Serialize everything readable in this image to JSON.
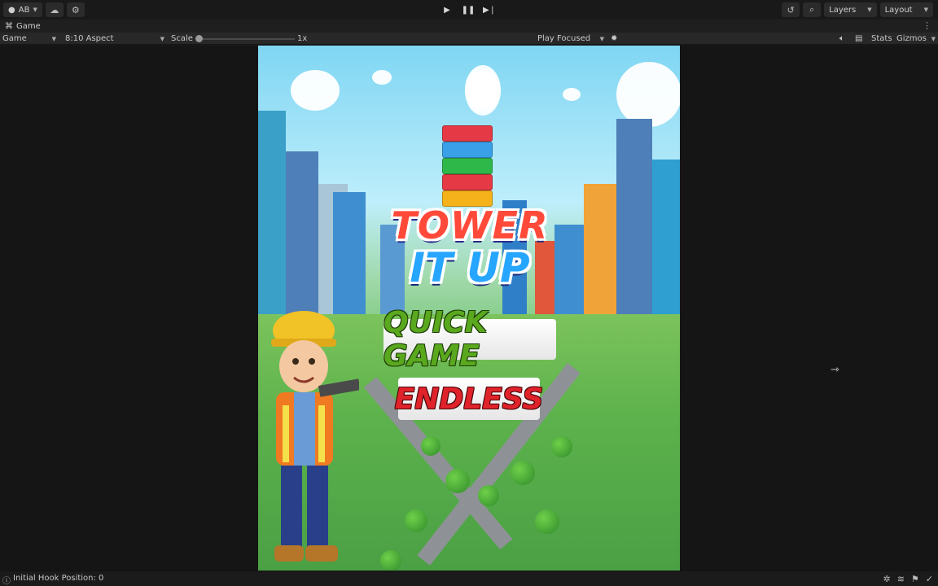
{
  "toolbar": {
    "account_label": "AB",
    "layers_label": "Layers",
    "layout_label": "Layout",
    "icons": [
      "account-icon",
      "cloud-icon",
      "settings-icon",
      "play-icon",
      "pause-icon",
      "step-icon",
      "history-icon",
      "search-icon"
    ]
  },
  "tab": {
    "label": "Game"
  },
  "gamebar": {
    "display_label": "Game",
    "aspect_label": "8:10 Aspect",
    "scale_label": "Scale",
    "scale_value": "1x",
    "scale_fraction": 0.0,
    "play_mode_label": "Play Focused",
    "stats_label": "Stats",
    "gizmos_label": "Gizmos"
  },
  "game": {
    "logo_line1": "TOWER",
    "logo_line2": "IT UP",
    "quick_game_label": "QUICK GAME",
    "endless_label": "ENDLESS"
  },
  "status": {
    "message": "Initial Hook Position: 0"
  },
  "colors": {
    "bg": "#191919",
    "panel": "#282828",
    "quick": "#5aa81e",
    "endless": "#e0232b"
  }
}
